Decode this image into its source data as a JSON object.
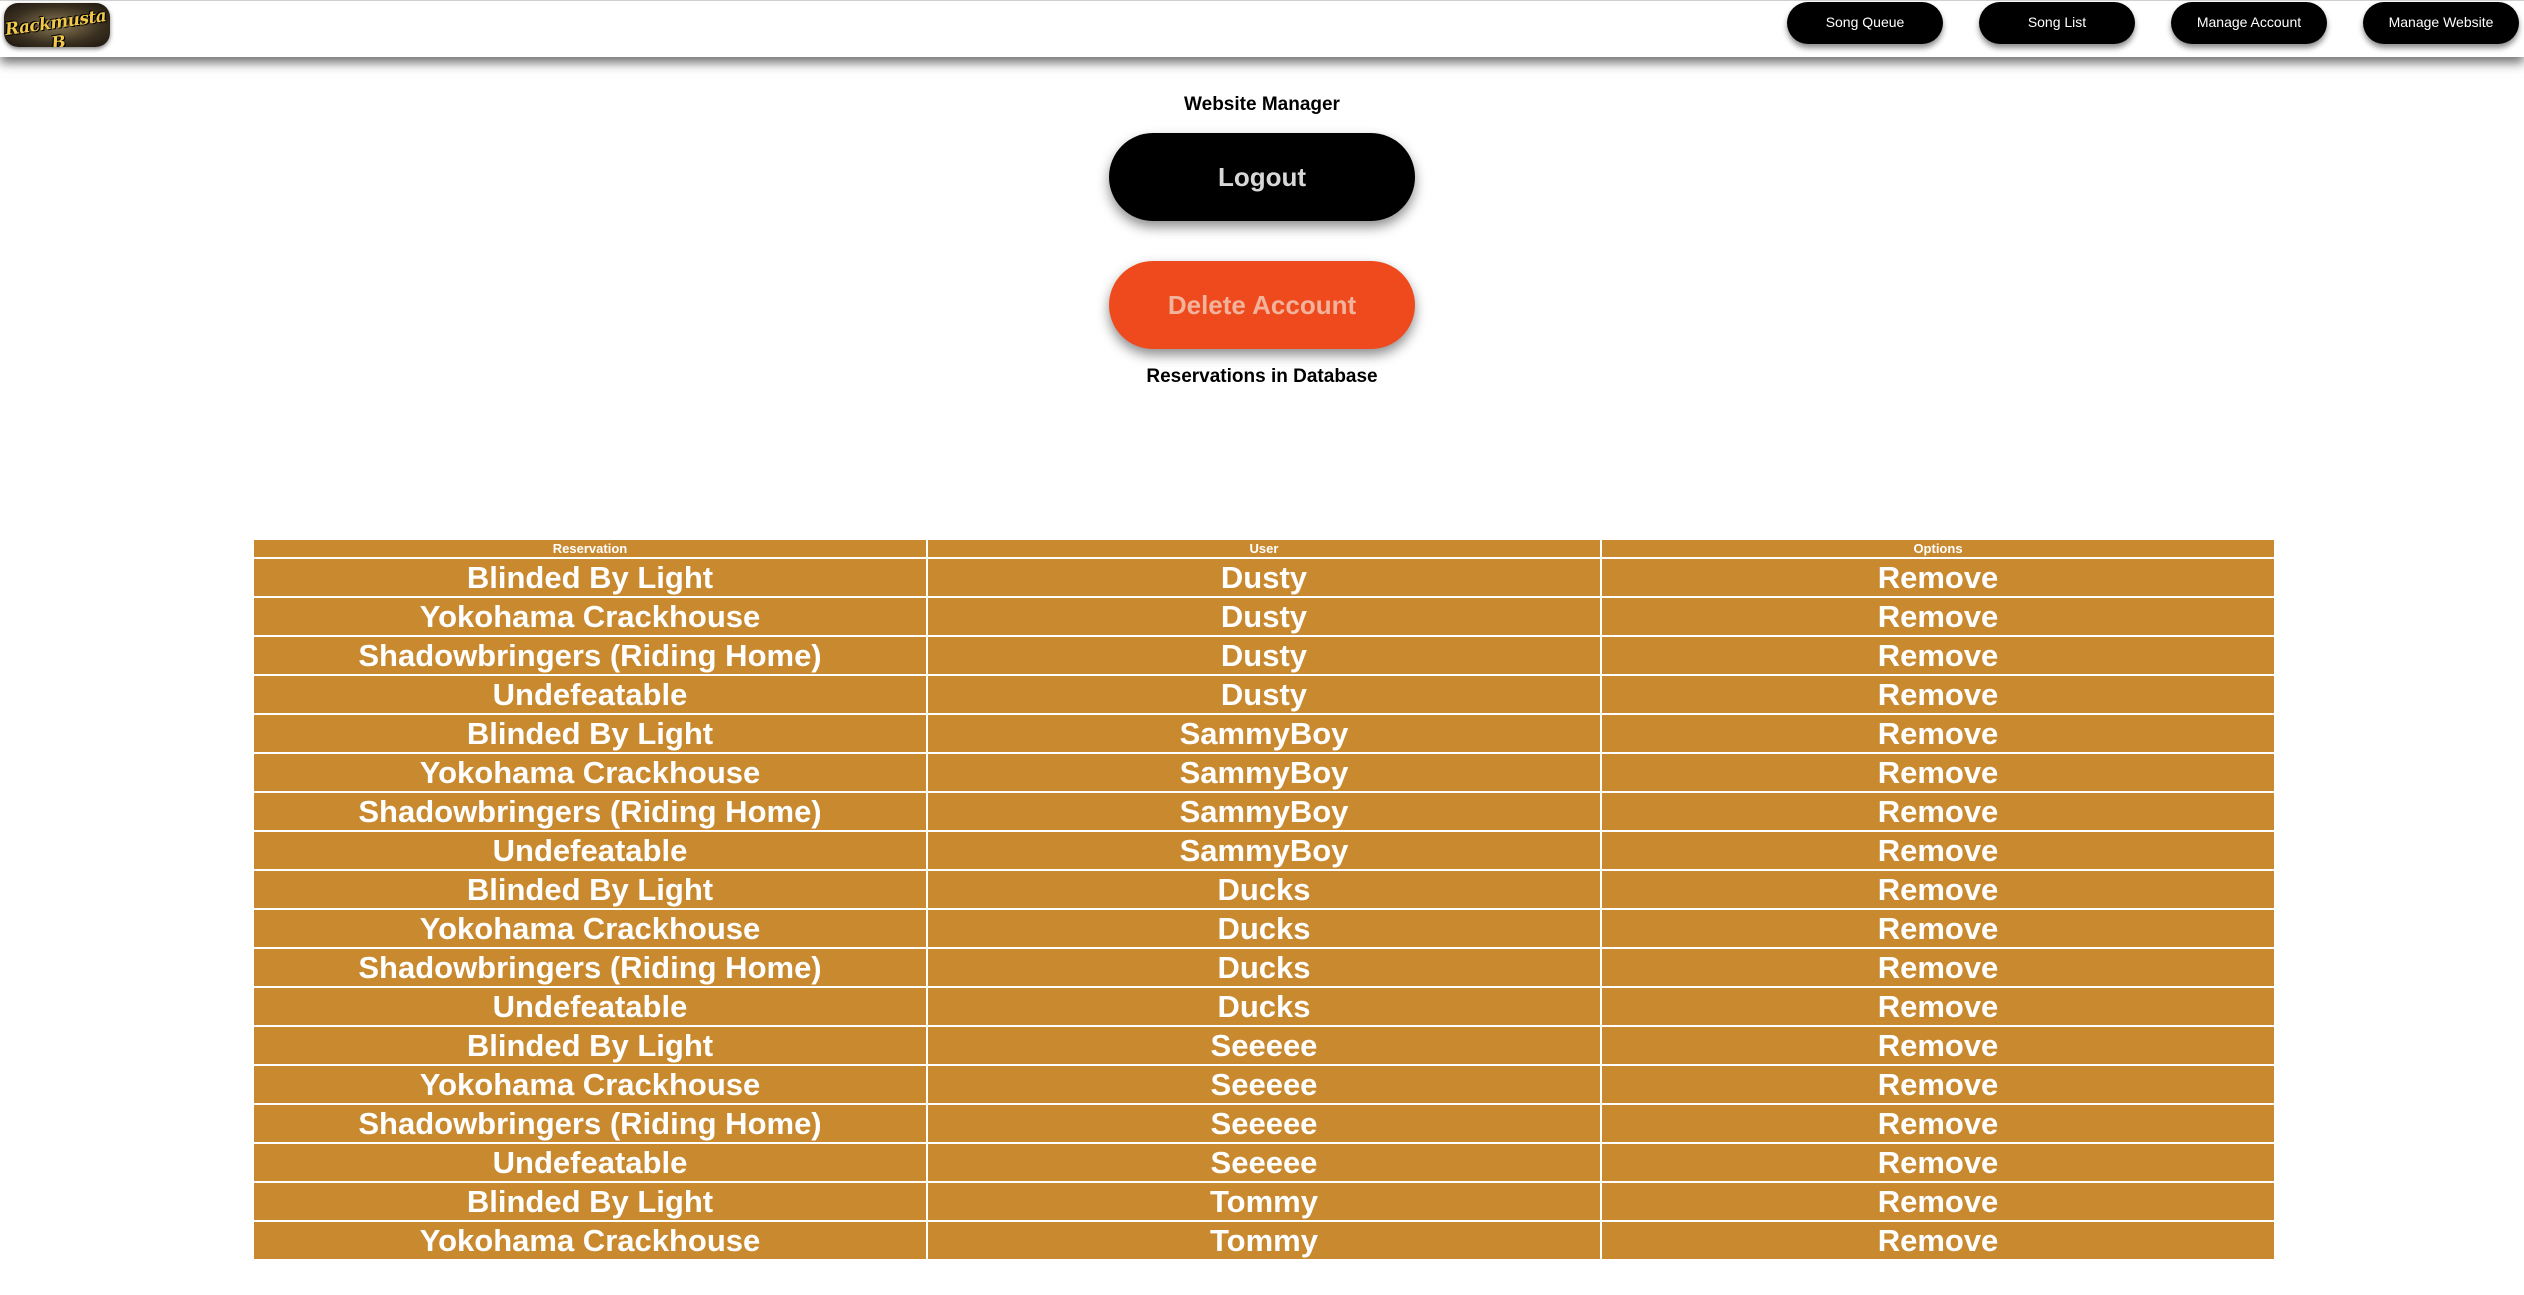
{
  "header": {
    "logo_text": "Rackmusta B",
    "nav": [
      {
        "label": "Song Queue"
      },
      {
        "label": "Song List"
      },
      {
        "label": "Manage Account"
      },
      {
        "label": "Manage Website"
      }
    ]
  },
  "main": {
    "title": "Website Manager",
    "logout_label": "Logout",
    "delete_label": "Delete Account",
    "reservations_title": "Reservations in Database"
  },
  "table": {
    "headers": [
      "Reservation",
      "User",
      "Options"
    ],
    "rows": [
      {
        "reservation": "Blinded By Light",
        "user": "Dusty",
        "option": "Remove"
      },
      {
        "reservation": "Yokohama Crackhouse",
        "user": "Dusty",
        "option": "Remove"
      },
      {
        "reservation": "Shadowbringers (Riding Home)",
        "user": "Dusty",
        "option": "Remove"
      },
      {
        "reservation": "Undefeatable",
        "user": "Dusty",
        "option": "Remove"
      },
      {
        "reservation": "Blinded By Light",
        "user": "SammyBoy",
        "option": "Remove"
      },
      {
        "reservation": "Yokohama Crackhouse",
        "user": "SammyBoy",
        "option": "Remove"
      },
      {
        "reservation": "Shadowbringers (Riding Home)",
        "user": "SammyBoy",
        "option": "Remove"
      },
      {
        "reservation": "Undefeatable",
        "user": "SammyBoy",
        "option": "Remove"
      },
      {
        "reservation": "Blinded By Light",
        "user": "Ducks",
        "option": "Remove"
      },
      {
        "reservation": "Yokohama Crackhouse",
        "user": "Ducks",
        "option": "Remove"
      },
      {
        "reservation": "Shadowbringers (Riding Home)",
        "user": "Ducks",
        "option": "Remove"
      },
      {
        "reservation": "Undefeatable",
        "user": "Ducks",
        "option": "Remove"
      },
      {
        "reservation": "Blinded By Light",
        "user": "Seeeee",
        "option": "Remove"
      },
      {
        "reservation": "Yokohama Crackhouse",
        "user": "Seeeee",
        "option": "Remove"
      },
      {
        "reservation": "Shadowbringers (Riding Home)",
        "user": "Seeeee",
        "option": "Remove"
      },
      {
        "reservation": "Undefeatable",
        "user": "Seeeee",
        "option": "Remove"
      },
      {
        "reservation": "Blinded By Light",
        "user": "Tommy",
        "option": "Remove"
      },
      {
        "reservation": "Yokohama Crackhouse",
        "user": "Tommy",
        "option": "Remove"
      }
    ]
  },
  "colors": {
    "table_cell": "#c9892f",
    "delete_button": "#ee4a1e",
    "nav_button": "#000000"
  }
}
